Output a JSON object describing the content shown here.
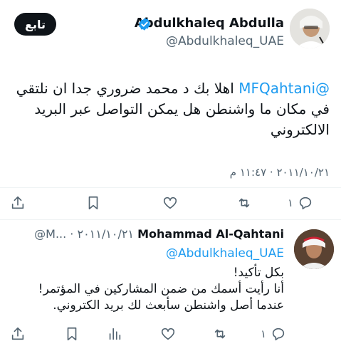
{
  "tweet": {
    "follow_label": "تابع",
    "author_name": "Abdulkhaleq Abdulla",
    "author_handle": "@Abdulkhaleq_UAE",
    "mention": "@MFQahtani",
    "body": " اهلا بك د محمد ضروري جدا ان نلتقي في مكان ما واشنطن هل يمكن التواصل عبر البريد الالكتروني",
    "timestamp": "٢٠١١/١٠/٢١ · ١١:٤٧ م",
    "actions": {
      "reply_count": "١",
      "icons": [
        "reply-icon",
        "retweet-icon",
        "like-icon",
        "bookmark-icon",
        "share-icon"
      ]
    }
  },
  "reply": {
    "author_name": "Mohammad Al-Qahtani",
    "meta": "@M... · ٢٠١١/١٠/٢١",
    "reply_to": "@Abdulkhaleq_UAE",
    "lines": [
      "بكل تأكيد!",
      "أنا رأيت أسمك من ضمن المشاركين في المؤتمر!",
      "عندما أصل واشنطن سأبعث لك بريد الكتروني."
    ],
    "actions": {
      "reply_count": "١"
    }
  },
  "colors": {
    "link": "#1d9bf0",
    "secondary_text": "#536471",
    "primary_text": "#0f1419",
    "divider": "#eff3f4"
  }
}
